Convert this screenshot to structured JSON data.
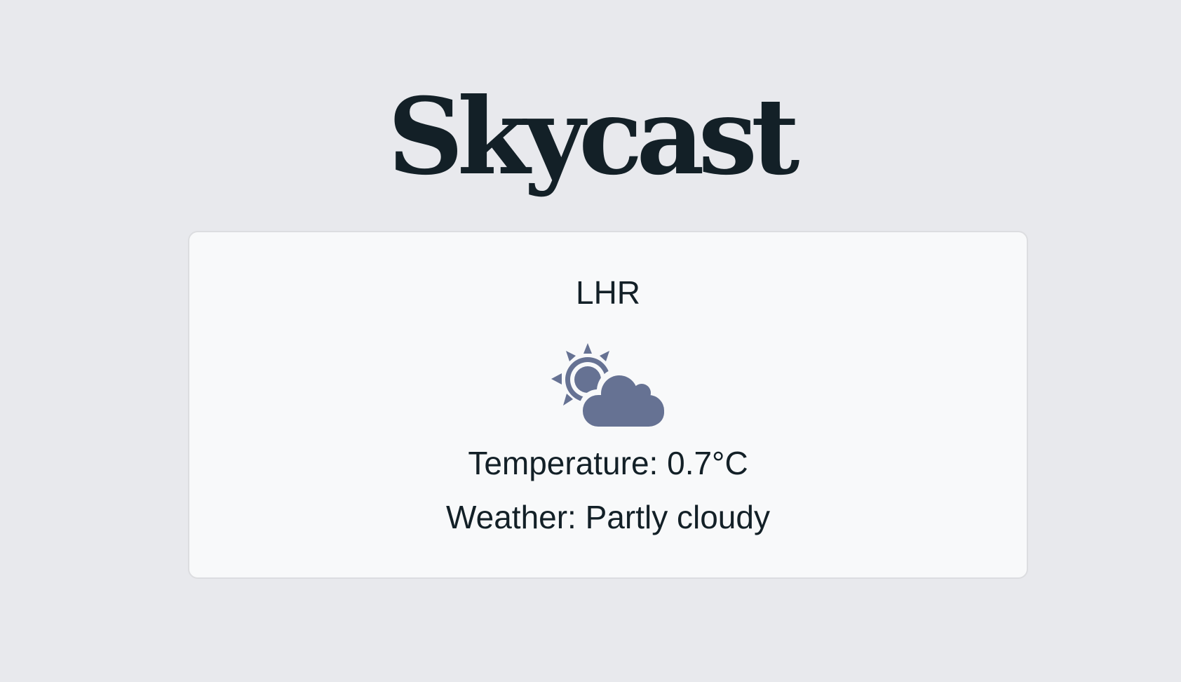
{
  "app": {
    "title": "Skycast"
  },
  "weather_card": {
    "location": "LHR",
    "icon": "partly-cloudy-icon",
    "temperature_text": "Temperature: 0.7°C",
    "condition_text": "Weather: Partly cloudy"
  },
  "colors": {
    "page_background": "#e8e9ed",
    "card_background": "#f8f9fa",
    "text": "#132027",
    "icon": "#667293"
  }
}
